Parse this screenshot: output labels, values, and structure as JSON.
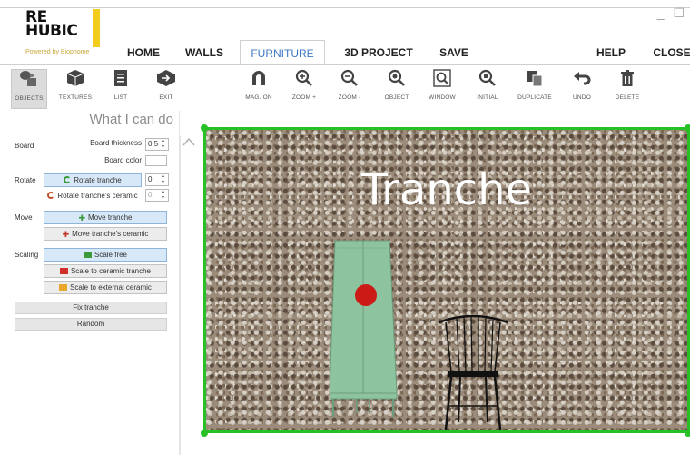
{
  "logo": {
    "text_line1": "RE",
    "text_line2": "HUBIC",
    "sub": "Powered by Biophome"
  },
  "window_controls": {
    "minimize": "_",
    "maximize": "☐"
  },
  "menu": [
    {
      "label": "HOME",
      "active": false
    },
    {
      "label": "WALLS",
      "active": false
    },
    {
      "label": "FURNITURE",
      "active": true
    },
    {
      "label": "3D PROJECT",
      "active": false
    },
    {
      "label": "SAVE",
      "active": false
    },
    {
      "label": "HELP",
      "active": false
    },
    {
      "label": "CLOSE",
      "active": false
    }
  ],
  "toolbar": [
    {
      "label": "OBJECTS",
      "icon": "objects-icon",
      "selected": true
    },
    {
      "label": "TEXTURES",
      "icon": "textures-icon"
    },
    {
      "label": "LIST",
      "icon": "list-icon"
    },
    {
      "label": "EXIT",
      "icon": "exit-icon"
    },
    {
      "label": "MAG. ON",
      "icon": "magnet-icon"
    },
    {
      "label": "ZOOM +",
      "icon": "zoom-in-icon"
    },
    {
      "label": "ZOOM -",
      "icon": "zoom-out-icon"
    },
    {
      "label": "OBJECT",
      "icon": "zoom-object-icon"
    },
    {
      "label": "WINDOW",
      "icon": "zoom-window-icon"
    },
    {
      "label": "INITIAL",
      "icon": "zoom-initial-icon"
    },
    {
      "label": "DUPLICATE",
      "icon": "duplicate-icon"
    },
    {
      "label": "UNDO",
      "icon": "undo-icon"
    },
    {
      "label": "DELETE",
      "icon": "trash-icon"
    }
  ],
  "panel": {
    "title": "What I can do",
    "board": {
      "label": "Board",
      "thickness_label": "Board thickness",
      "thickness_value": "0.5",
      "color_label": "Board color"
    },
    "rotate": {
      "label": "Rotate",
      "rotate_tranche": "Rotate tranche",
      "rotate_tranche_value": "0",
      "rotate_ceramic": "Rotate tranche's ceramic",
      "rotate_ceramic_value": "0"
    },
    "move": {
      "label": "Move",
      "move_tranche": "Move tranche",
      "move_ceramic": "Move tranche's ceramic"
    },
    "scaling": {
      "label": "Scaling",
      "scale_free": "Scale free",
      "scale_ceramic": "Scale to ceramic tranche",
      "scale_external": "Scale to external ceramic"
    },
    "fix_tranche": "Fix tranche",
    "random": "Random"
  },
  "canvas": {
    "title": "Tranche"
  },
  "colors": {
    "accent": "#3b78c2",
    "selection": "#27c025",
    "cabinet": "#8ec3a0",
    "marker": "#cc1a16",
    "logo_yellow": "#f2cc1c"
  }
}
